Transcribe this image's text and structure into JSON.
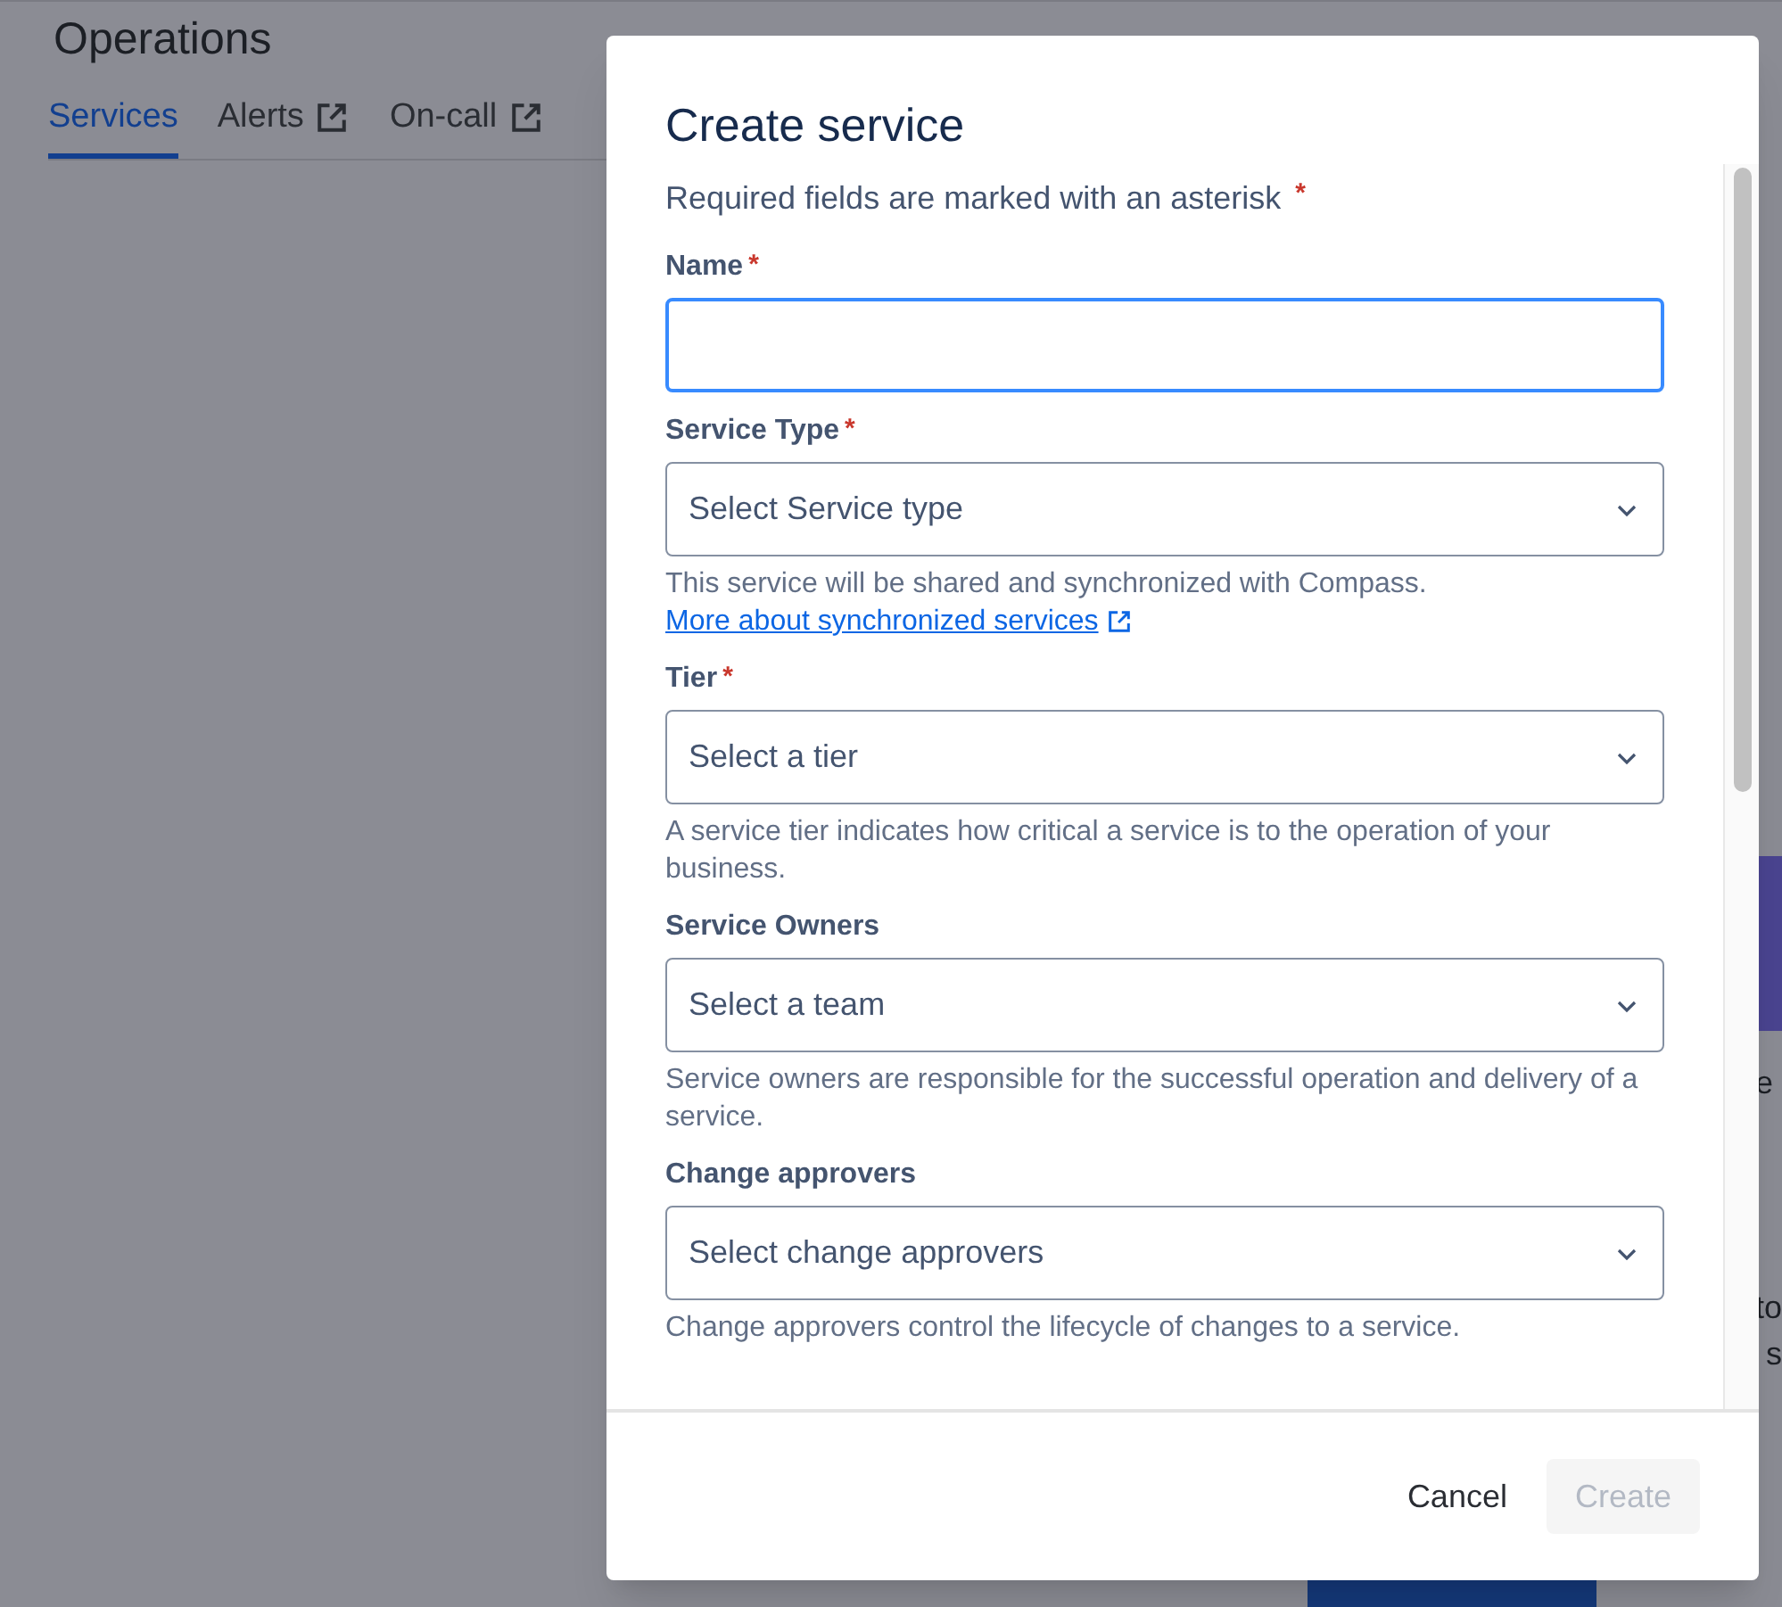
{
  "page": {
    "title": "Operations",
    "tabs": [
      {
        "label": "Services",
        "selected": true,
        "external": false
      },
      {
        "label": "Alerts",
        "selected": false,
        "external": true
      },
      {
        "label": "On-call",
        "selected": false,
        "external": true
      }
    ],
    "background_fragments": [
      "e",
      "to",
      "s"
    ]
  },
  "dialog": {
    "title": "Create service",
    "required_note": "Required fields are marked with an asterisk",
    "required_mark": "*",
    "fields": [
      {
        "kind": "text",
        "label": "Name",
        "required": true,
        "focused": true
      },
      {
        "kind": "select",
        "label": "Service Type",
        "required": true,
        "placeholder": "Select Service type",
        "help": "This service will be shared and synchronized with Compass.",
        "help_link": "More about synchronized services"
      },
      {
        "kind": "select",
        "label": "Tier",
        "required": true,
        "placeholder": "Select a tier",
        "help": "A service tier indicates how critical a service is to the operation of your business."
      },
      {
        "kind": "select",
        "label": "Service Owners",
        "required": false,
        "placeholder": "Select a team",
        "help": "Service owners are responsible for the successful operation and delivery of a service."
      },
      {
        "kind": "select",
        "label": "Change approvers",
        "required": false,
        "placeholder": "Select change approvers",
        "help": "Change approvers control the lifecycle of changes to a service."
      }
    ],
    "buttons": [
      {
        "label": "Cancel",
        "kind": "subtle",
        "disabled": false
      },
      {
        "label": "Create",
        "kind": "primary",
        "disabled": true
      }
    ]
  }
}
